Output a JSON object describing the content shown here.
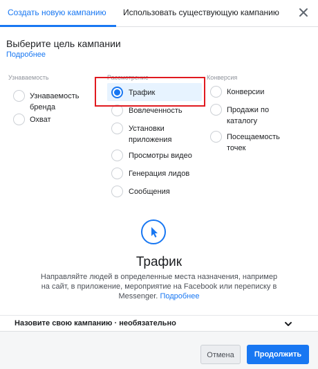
{
  "tabs": {
    "create": "Создать новую кампанию",
    "existing": "Использовать существующую кампанию"
  },
  "heading": {
    "title": "Выберите цель кампании",
    "learn_more": "Подробнее"
  },
  "columns": [
    {
      "label": "Узнаваемость",
      "options": [
        "Узнаваемость бренда",
        "Охват"
      ]
    },
    {
      "label": "Рассмотрение",
      "options": [
        "Трафик",
        "Вовлеченность",
        "Установки приложения",
        "Просмотры видео",
        "Генерация лидов",
        "Сообщения"
      ]
    },
    {
      "label": "Конверсия",
      "options": [
        "Конверсии",
        "Продажи по каталогу",
        "Посещаемость точек"
      ]
    }
  ],
  "selected_option": "Трафик",
  "detail": {
    "icon": "cursor-pointer-icon",
    "title": "Трафик",
    "description": "Направляйте людей в определенные места назначения, например на сайт, в приложение, мероприятие на Facebook или переписку в Messenger.",
    "learn_more": "Подробнее"
  },
  "campaign_name": {
    "label": "Назовите свою кампанию · необязательно"
  },
  "footer": {
    "cancel": "Отмена",
    "continue": "Продолжить"
  },
  "colors": {
    "accent": "#1877f2",
    "highlight_box": "#e0191f",
    "selected_bg": "#e7f3ff"
  }
}
